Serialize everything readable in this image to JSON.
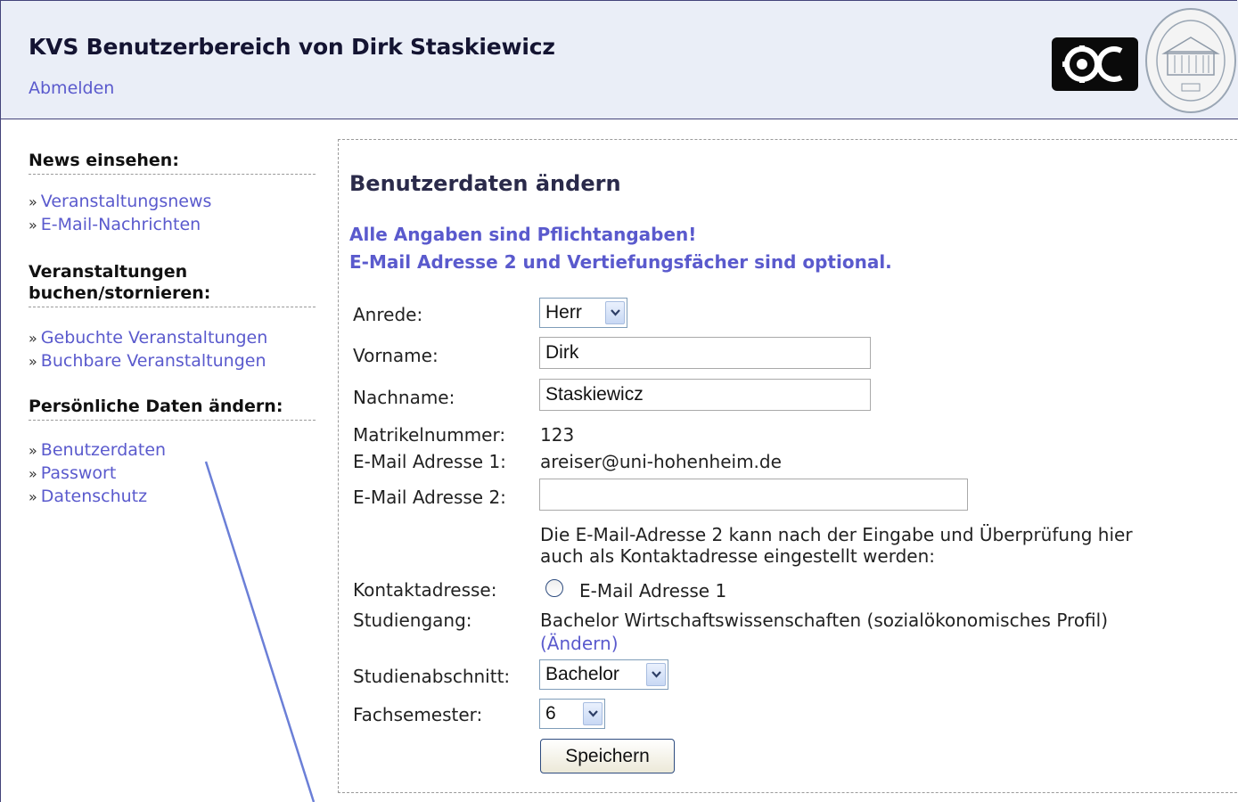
{
  "header": {
    "title": "KVS Benutzerbereich von Dirk Staskiewicz",
    "logout": "Abmelden"
  },
  "sidebar": {
    "sections": [
      {
        "heading": "News einsehen:",
        "links": [
          "Veranstaltungsnews",
          "E-Mail-Nachrichten"
        ]
      },
      {
        "heading_line1": "Veranstaltungen",
        "heading_line2": "buchen/stornieren:",
        "links": [
          "Gebuchte Veranstaltungen",
          "Buchbare Veranstaltungen"
        ]
      },
      {
        "heading": "Persönliche Daten ändern:",
        "links": [
          "Benutzerdaten",
          "Passwort",
          "Datenschutz"
        ]
      }
    ],
    "bullet": "»"
  },
  "main": {
    "title": "Benutzerdaten ändern",
    "notice_line1": "Alle Angaben sind Pflichtangaben!",
    "notice_line2": "E-Mail Adresse 2 und Vertiefungsfächer sind optional.",
    "form": {
      "salutation": {
        "label": "Anrede:",
        "value": "Herr"
      },
      "firstname": {
        "label": "Vorname:",
        "value": "Dirk"
      },
      "lastname": {
        "label": "Nachname:",
        "value": "Staskiewicz"
      },
      "matriculation": {
        "label": "Matrikelnummer:",
        "value": "123"
      },
      "email1": {
        "label": "E-Mail Adresse 1:",
        "value": "areiser@uni-hohenheim.de"
      },
      "email2": {
        "label": "E-Mail Adresse 2:",
        "value": ""
      },
      "email2_hint_line1": "Die E-Mail-Adresse 2 kann nach der Eingabe und Überprüfung hier",
      "email2_hint_line2": "auch als Kontaktadresse eingestellt werden:",
      "contact": {
        "label": "Kontaktadresse:",
        "option": "E-Mail Adresse 1"
      },
      "program": {
        "label": "Studiengang:",
        "value": "Bachelor Wirtschaftswissenschaften (sozialökonomisches Profil)",
        "change_link": "(Ändern)"
      },
      "stage": {
        "label": "Studienabschnitt:",
        "value": "Bachelor"
      },
      "semester": {
        "label": "Fachsemester:",
        "value": "6"
      },
      "save_label": "Speichern"
    }
  },
  "colors": {
    "link": "#5a5acd",
    "header_bg": "#eaeef7",
    "border": "#44447a",
    "annotation_line": "#6b7fd7"
  },
  "icons": [
    "oc-logo-icon",
    "university-seal-icon",
    "chevron-down-icon",
    "radio-icon"
  ]
}
